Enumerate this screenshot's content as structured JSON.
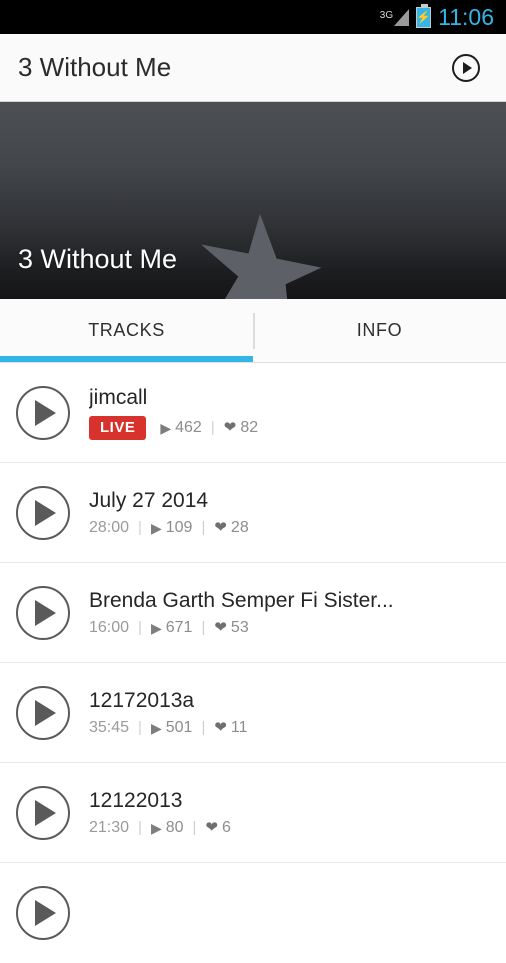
{
  "status_bar": {
    "network_label": "3G",
    "network_icon": "signal-3g-icon",
    "battery_icon": "battery-charging-icon",
    "time": "11:06",
    "time_color": "#33b5e5"
  },
  "action_bar": {
    "title": "3 Without Me",
    "play_icon": "play-circle-icon"
  },
  "hero": {
    "title": "3 Without Me",
    "watermark_icon": "star-icon"
  },
  "tabs": {
    "items": [
      {
        "label": "TRACKS",
        "selected": true
      },
      {
        "label": "INFO",
        "selected": false
      }
    ],
    "indicator_color": "#33b5e5"
  },
  "tracks": {
    "play_icon": "play-circle-icon",
    "plays_icon": "play-triangle-icon",
    "likes_icon": "heart-icon",
    "separator": "|",
    "items": [
      {
        "title": "jimcall",
        "badge": "LIVE",
        "badge_color": "#d8322c",
        "duration": null,
        "plays": "462",
        "likes": "82"
      },
      {
        "title": "July 27 2014",
        "badge": null,
        "duration": "28:00",
        "plays": "109",
        "likes": "28"
      },
      {
        "title": "Brenda Garth Semper Fi Sister...",
        "badge": null,
        "duration": "16:00",
        "plays": "671",
        "likes": "53"
      },
      {
        "title": "12172013a",
        "badge": null,
        "duration": "35:45",
        "plays": "501",
        "likes": "11"
      },
      {
        "title": "12122013",
        "badge": null,
        "duration": "21:30",
        "plays": "80",
        "likes": "6"
      }
    ]
  }
}
